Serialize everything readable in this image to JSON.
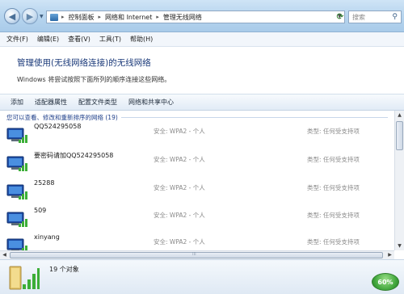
{
  "address": {
    "crumbs": [
      "控制面板",
      "网络和 Internet",
      "管理无线网络"
    ],
    "separator": "▸"
  },
  "search": {
    "placeholder": "搜索"
  },
  "menu": {
    "items": [
      "文件(F)",
      "编辑(E)",
      "查看(V)",
      "工具(T)",
      "帮助(H)"
    ]
  },
  "header": {
    "title": "管理使用(无线网络连接)的无线网络",
    "description": "Windows 将尝试按照下面所列的顺序连接这些网络。"
  },
  "commands": [
    "添加",
    "适配器属性",
    "配置文件类型",
    "网络和共享中心"
  ],
  "list": {
    "group_title": "您可以查看、修改和重新排序的网络 (19)",
    "networks": [
      {
        "name": "QQ524295058",
        "security": "安全: WPA2 - 个人",
        "type": "类型: 任何受支持项"
      },
      {
        "name": "要密码请加QQ524295058",
        "security": "安全: WPA2 - 个人",
        "type": "类型: 任何受支持项"
      },
      {
        "name": "25288",
        "security": "安全: WPA2 - 个人",
        "type": "类型: 任何受支持项"
      },
      {
        "name": "509",
        "security": "安全: WPA2 - 个人",
        "type": "类型: 任何受支持项"
      },
      {
        "name": "xinyang",
        "security": "安全: WPA2 - 个人",
        "type": "类型: 任何受支持项"
      }
    ]
  },
  "status": {
    "count": "19 个对象"
  },
  "badge": {
    "label": "60%"
  },
  "colors": {
    "accent": "#1b3a7a",
    "signal": "#3cae37"
  }
}
